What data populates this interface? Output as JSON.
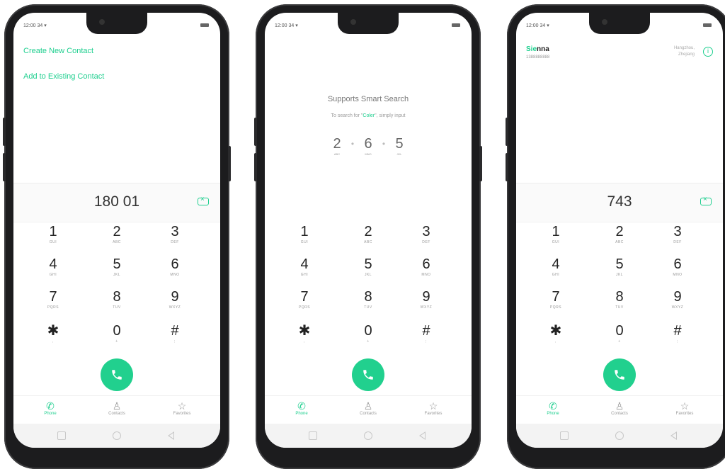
{
  "colors": {
    "accent": "#1fcf8f",
    "call_button": "#21d08e"
  },
  "phones": [
    {
      "status_time": "12:00 34 ▾",
      "links": [
        "Create New Contact",
        "Add to Existing Contact"
      ],
      "number": "180 01"
    },
    {
      "status_time": "12:00 34 ▾",
      "smart_search": {
        "title": "Supports Smart Search",
        "hint_prefix": "To search for \"",
        "hint_name": "Coler",
        "hint_suffix": "\", simply input",
        "sequence": [
          {
            "digit": "2",
            "letters": "ABC"
          },
          {
            "digit": "6",
            "letters": "MNO"
          },
          {
            "digit": "5",
            "letters": "JKL"
          }
        ]
      }
    },
    {
      "status_time": "12:00 34 ▾",
      "contact": {
        "name_highlight": "Sie",
        "name_rest": "nna",
        "number": "1388888888",
        "location": "Hangzhou, Zhejiang"
      },
      "number": "743"
    }
  ],
  "keypad": [
    {
      "digit": "1",
      "letters": "GUI"
    },
    {
      "digit": "2",
      "letters": "ABC"
    },
    {
      "digit": "3",
      "letters": "DEF"
    },
    {
      "digit": "4",
      "letters": "GHI"
    },
    {
      "digit": "5",
      "letters": "JKL"
    },
    {
      "digit": "6",
      "letters": "MNO"
    },
    {
      "digit": "7",
      "letters": "PQRS"
    },
    {
      "digit": "8",
      "letters": "TUV"
    },
    {
      "digit": "9",
      "letters": "WXYZ"
    },
    {
      "digit": "✱",
      "letters": ","
    },
    {
      "digit": "0",
      "letters": "+"
    },
    {
      "digit": "#",
      "letters": ";"
    }
  ],
  "tabs": [
    {
      "label": "Phone",
      "icon": "phone-icon",
      "active": true
    },
    {
      "label": "Contacts",
      "icon": "person-icon",
      "active": false
    },
    {
      "label": "Favorites",
      "icon": "star-icon",
      "active": false
    }
  ]
}
